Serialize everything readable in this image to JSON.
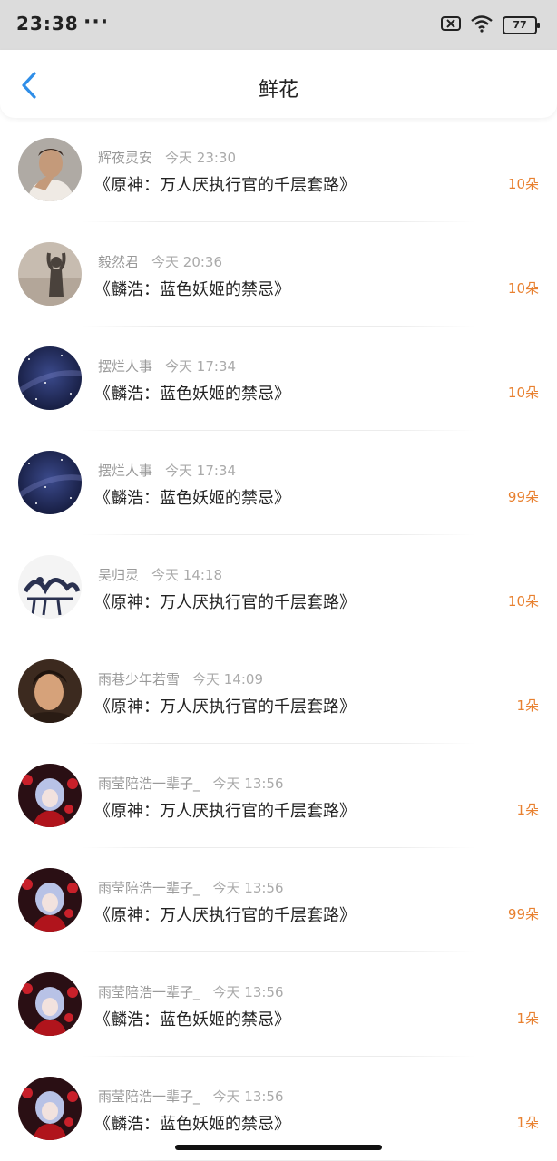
{
  "status_bar": {
    "time": "23:38",
    "dots": "···",
    "battery": "77"
  },
  "header": {
    "title": "鲜花"
  },
  "colors": {
    "accent": "#2f8ee8",
    "count": "#e8802f"
  },
  "rows": [
    {
      "user": "辉夜灵安",
      "time": "今天 23:30",
      "book": "《原神：万人厌执行官的千层套路》",
      "count": "10朵",
      "avatar": "man-portrait"
    },
    {
      "user": "毅然君",
      "time": "今天 20:36",
      "book": "《麟浩：蓝色妖姬的禁忌》",
      "count": "10朵",
      "avatar": "silhouette"
    },
    {
      "user": "摆烂人事",
      "time": "今天 17:34",
      "book": "《麟浩：蓝色妖姬的禁忌》",
      "count": "10朵",
      "avatar": "starry-sky"
    },
    {
      "user": "摆烂人事",
      "time": "今天 17:34",
      "book": "《麟浩：蓝色妖姬的禁忌》",
      "count": "99朵",
      "avatar": "starry-sky"
    },
    {
      "user": "吴归灵",
      "time": "今天 14:18",
      "book": "《原神：万人厌执行官的千层套路》",
      "count": "10朵",
      "avatar": "ink-art"
    },
    {
      "user": "雨巷少年若雪",
      "time": "今天 14:09",
      "book": "《原神：万人厌执行官的千层套路》",
      "count": "1朵",
      "avatar": "man-portrait-2"
    },
    {
      "user": "雨莹陪浩一辈子_",
      "time": "今天 13:56",
      "book": "《原神：万人厌执行官的千层套路》",
      "count": "1朵",
      "avatar": "anime-red"
    },
    {
      "user": "雨莹陪浩一辈子_",
      "time": "今天 13:56",
      "book": "《原神：万人厌执行官的千层套路》",
      "count": "99朵",
      "avatar": "anime-red"
    },
    {
      "user": "雨莹陪浩一辈子_",
      "time": "今天 13:56",
      "book": "《麟浩：蓝色妖姬的禁忌》",
      "count": "1朵",
      "avatar": "anime-red"
    },
    {
      "user": "雨莹陪浩一辈子_",
      "time": "今天 13:56",
      "book": "《麟浩：蓝色妖姬的禁忌》",
      "count": "1朵",
      "avatar": "anime-red"
    }
  ]
}
